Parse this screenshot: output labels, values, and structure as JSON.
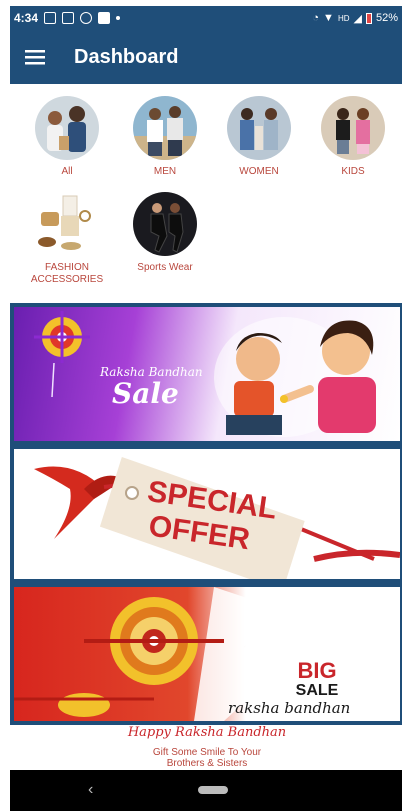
{
  "status_bar": {
    "time": "4:34",
    "signal": "HD",
    "battery": "52%"
  },
  "app_bar": {
    "title": "Dashboard",
    "menu_icon": "hamburger-menu-icon"
  },
  "categories": [
    {
      "label": "All",
      "image": "family-shopping-photo"
    },
    {
      "label": "MEN",
      "image": "men-fashion-photo"
    },
    {
      "label": "WOMEN",
      "image": "women-fashion-photo"
    },
    {
      "label": "KIDS",
      "image": "kids-fashion-photo"
    },
    {
      "label": "FASHION ACCESSORIES",
      "image": "fashion-accessories-photo"
    },
    {
      "label": "Sports Wear",
      "image": "sports-wear-photo"
    }
  ],
  "banners": [
    {
      "script": "Raksha Bandhan",
      "headline": "Sale",
      "name": "raksha-bandhan-sale-banner"
    },
    {
      "line1": "SPECIAL",
      "line2": "OFFER",
      "name": "special-offer-banner"
    },
    {
      "line1": "BIG",
      "line2": "SALE",
      "script": "raksha bandhan",
      "name": "big-sale-banner"
    },
    {
      "title": "Happy Raksha Bandhan",
      "line1": "Gift Some Smile To Your",
      "line2": "Brothers & Sisters",
      "name": "happy-raksha-bandhan-banner"
    }
  ],
  "colors": {
    "primary": "#1f4e79",
    "category_label": "#b9473d",
    "nav_bar": "#000000"
  },
  "nav_bar": {
    "back_icon": "back-chevron-icon",
    "home_icon": "home-pill-icon"
  }
}
